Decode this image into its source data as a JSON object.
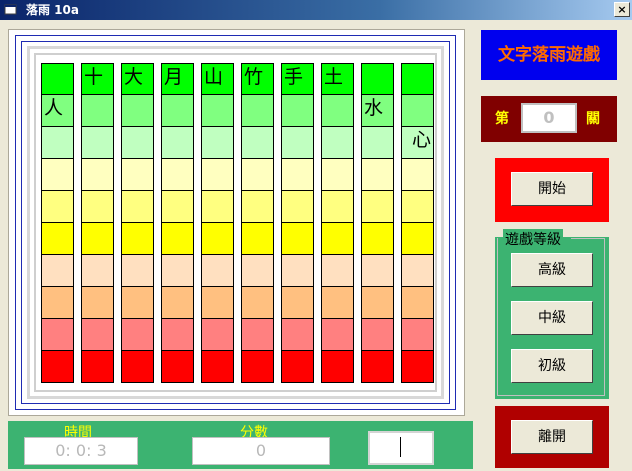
{
  "window": {
    "title": "落雨 10a",
    "close_glyph": "×"
  },
  "game_title": "文字落雨遊戲",
  "level": {
    "prefix": "第",
    "value": "0",
    "suffix": "關"
  },
  "buttons": {
    "start": "開始",
    "exit": "離開"
  },
  "difficulty": {
    "legend": "遊戲等級",
    "options": [
      "高級",
      "中級",
      "初級"
    ]
  },
  "status": {
    "time_label": "時間",
    "time_value": "0:  0:  3",
    "score_label": "分數",
    "score_value": "0"
  },
  "row_colors": [
    "#00ff00",
    "#80ff80",
    "#c0ffc0",
    "#ffffc0",
    "#ffff80",
    "#ffff00",
    "#ffe0c0",
    "#ffc080",
    "#ff8080",
    "#ff0000"
  ],
  "columns": [
    {
      "chars": [
        {
          "row": 1,
          "text": "人"
        }
      ]
    },
    {
      "chars": [
        {
          "row": 0,
          "text": "十"
        }
      ]
    },
    {
      "chars": [
        {
          "row": 0,
          "text": "大"
        }
      ]
    },
    {
      "chars": [
        {
          "row": 0,
          "text": "月"
        }
      ]
    },
    {
      "chars": [
        {
          "row": 0,
          "text": "山"
        }
      ]
    },
    {
      "chars": [
        {
          "row": 0,
          "text": "竹"
        }
      ]
    },
    {
      "chars": [
        {
          "row": 0,
          "text": "手"
        }
      ]
    },
    {
      "chars": [
        {
          "row": 0,
          "text": "土"
        }
      ]
    },
    {
      "chars": [
        {
          "row": 1,
          "text": "水"
        }
      ]
    },
    {
      "chars": [
        {
          "row": 2,
          "text": "心",
          "align": "right"
        }
      ]
    }
  ]
}
